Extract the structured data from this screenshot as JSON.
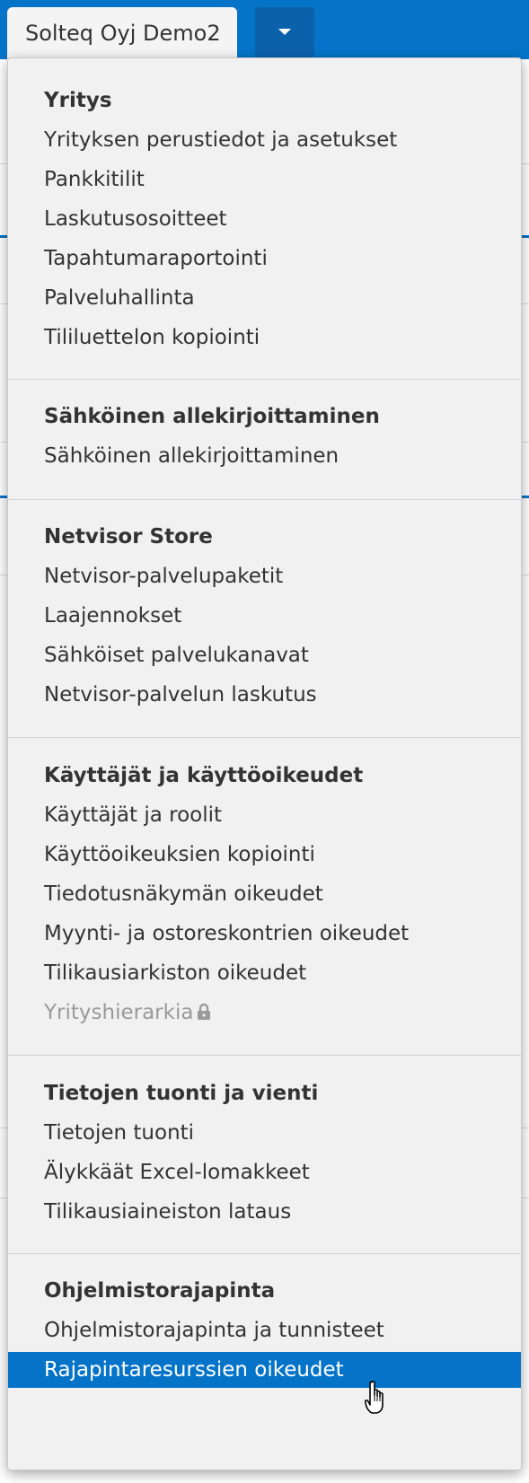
{
  "header": {
    "company_label": "Solteq Oyj Demo2",
    "toggle_icon": "caret-down-icon"
  },
  "menu": {
    "sections": [
      {
        "title": "Yritys",
        "items": [
          {
            "label": "Yrityksen perustiedot ja asetukset"
          },
          {
            "label": "Pankkitilit"
          },
          {
            "label": "Laskutusosoitteet"
          },
          {
            "label": "Tapahtumaraportointi"
          },
          {
            "label": "Palveluhallinta"
          },
          {
            "label": "Tililuettelon kopiointi"
          }
        ]
      },
      {
        "title": "Sähköinen allekirjoittaminen",
        "items": [
          {
            "label": "Sähköinen allekirjoittaminen"
          }
        ]
      },
      {
        "title": "Netvisor Store",
        "items": [
          {
            "label": "Netvisor-palvelupaketit"
          },
          {
            "label": "Laajennokset"
          },
          {
            "label": "Sähköiset palvelukanavat"
          },
          {
            "label": "Netvisor-palvelun laskutus"
          }
        ]
      },
      {
        "title": "Käyttäjät ja käyttöoikeudet",
        "items": [
          {
            "label": "Käyttäjät ja roolit"
          },
          {
            "label": "Käyttöoikeuksien kopiointi"
          },
          {
            "label": "Tiedotusnäkymän oikeudet"
          },
          {
            "label": "Myynti- ja ostoreskontrien oikeudet"
          },
          {
            "label": "Tilikausiarkiston oikeudet"
          },
          {
            "label": "Yrityshierarkia",
            "disabled": true,
            "icon": "lock-icon"
          }
        ]
      },
      {
        "title": "Tietojen tuonti ja vienti",
        "items": [
          {
            "label": "Tietojen tuonti"
          },
          {
            "label": "Älykkäät Excel-lomakkeet"
          },
          {
            "label": "Tilikausiaineiston lataus"
          }
        ]
      },
      {
        "title": "Ohjelmistorajapinta",
        "items": [
          {
            "label": "Ohjelmistorajapinta ja tunnisteet"
          },
          {
            "label": "Rajapintaresurssien oikeudet",
            "active": true
          }
        ]
      }
    ]
  },
  "colors": {
    "brand_blue": "#0573c8",
    "toggle_blue": "#0b62ab",
    "menu_bg": "#f1f1f1",
    "text": "#333333",
    "disabled_text": "#9a9a9a"
  },
  "cursor": "hand-pointer-icon"
}
